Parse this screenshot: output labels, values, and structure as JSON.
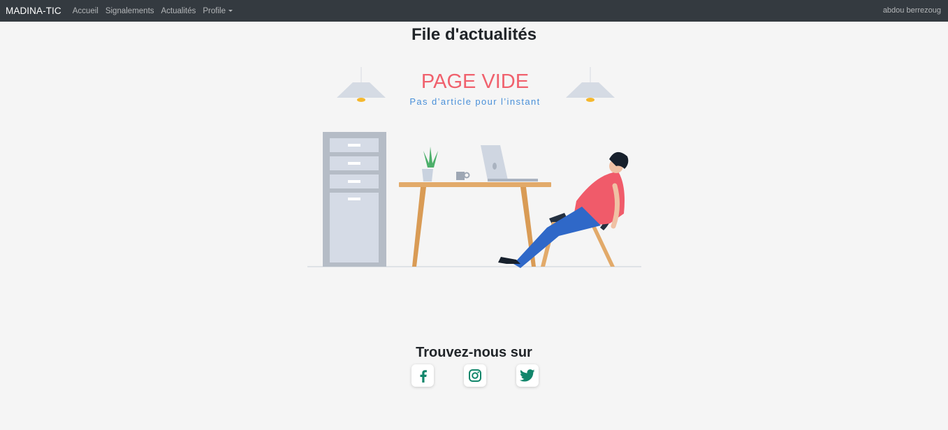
{
  "navbar": {
    "brand": "MADINA-TIC",
    "links": [
      "Accueil",
      "Signalements",
      "Actualités"
    ],
    "profile_label": "Profile",
    "user_name": "abdou berrezoug"
  },
  "main": {
    "title": "File d'actualités",
    "empty_state": {
      "heading": "PAGE VIDE",
      "subtext": "Pas d’article pour l’instant"
    }
  },
  "footer": {
    "title": "Trouvez-nous sur",
    "social": [
      {
        "icon": "facebook-icon"
      },
      {
        "icon": "instagram-icon"
      },
      {
        "icon": "twitter-icon"
      }
    ]
  },
  "colors": {
    "navbar_bg": "#343a40",
    "page_bg": "#f5f5f5",
    "social_icon": "#12866b",
    "empty_heading": "#f0616d",
    "empty_subtext": "#4a90d9"
  }
}
